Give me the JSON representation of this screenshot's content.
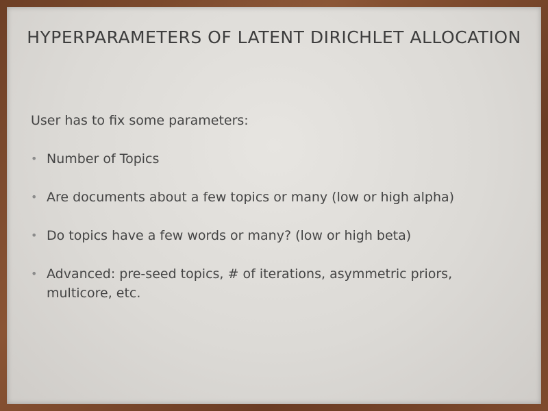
{
  "slide": {
    "title": "HYPERPARAMETERS OF LATENT DIRICHLET ALLOCATION",
    "intro": "User has to fix some parameters:",
    "bullet_glyph": "•",
    "bullets": [
      "Number of Topics",
      "Are documents about a few topics or many (low or high alpha)",
      "Do topics have a few words or many? (low or high beta)",
      "Advanced: pre-seed topics, # of iterations, asymmetric priors, multicore, etc."
    ]
  },
  "colors": {
    "frame": "#7a4a2e",
    "slide_background": "#dcdad6",
    "title_text": "#3d3d3d",
    "body_text": "#444444",
    "bullet": "#8b8b8b"
  }
}
